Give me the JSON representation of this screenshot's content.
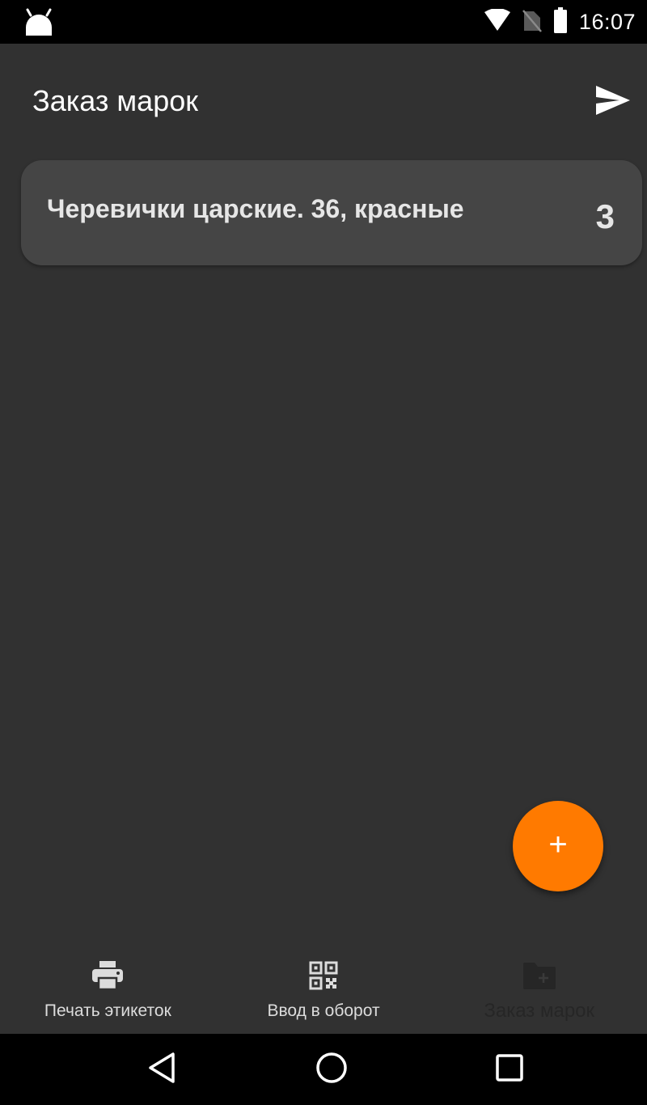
{
  "status_bar": {
    "time": "16:07",
    "icons": [
      "android-icon",
      "wifi-icon",
      "no-sim-icon",
      "battery-icon"
    ]
  },
  "app_bar": {
    "title": "Заказ марок",
    "action_icon": "send-icon"
  },
  "list": {
    "items": [
      {
        "title": "Черевички царские. 36, красные",
        "count": "3"
      }
    ]
  },
  "fab": {
    "label": "+",
    "color": "#ff7a00"
  },
  "bottom_nav": {
    "items": [
      {
        "label": "Печать этикеток",
        "icon": "printer-icon",
        "active": false
      },
      {
        "label": "Ввод в оборот",
        "icon": "qr-code-icon",
        "active": false
      },
      {
        "label": "Заказ марок",
        "icon": "folder-add-icon",
        "active": true
      }
    ]
  },
  "system_nav": {
    "icons": [
      "back-icon",
      "home-icon",
      "recents-icon"
    ]
  },
  "colors": {
    "background": "#313131",
    "card": "#454545",
    "accent": "#ff7a00",
    "text": "#e6e6e6"
  }
}
